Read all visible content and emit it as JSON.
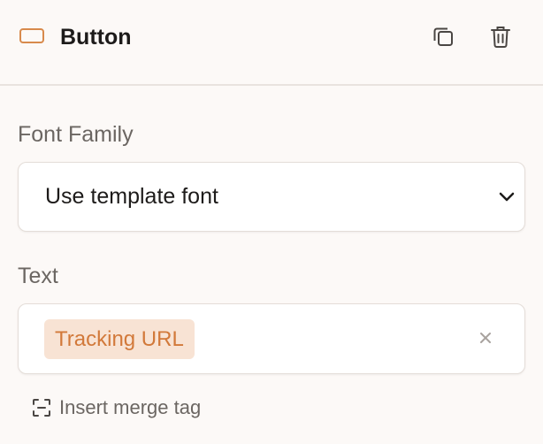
{
  "header": {
    "title": "Button",
    "block_icon": "button-block-icon",
    "actions": [
      {
        "icon": "duplicate-icon"
      },
      {
        "icon": "trash-icon"
      }
    ]
  },
  "font_family": {
    "label": "Font Family",
    "selected": "Use template font",
    "icon": "chevron-down-icon"
  },
  "text": {
    "label": "Text",
    "tag": "Tracking URL",
    "clear_icon": "close-icon"
  },
  "merge": {
    "icon": "merge-tag-icon",
    "label": "Insert merge tag"
  },
  "colors": {
    "accent": "#d2793a",
    "chip_bg": "#f8e3d4",
    "background": "#fcf9f7"
  }
}
